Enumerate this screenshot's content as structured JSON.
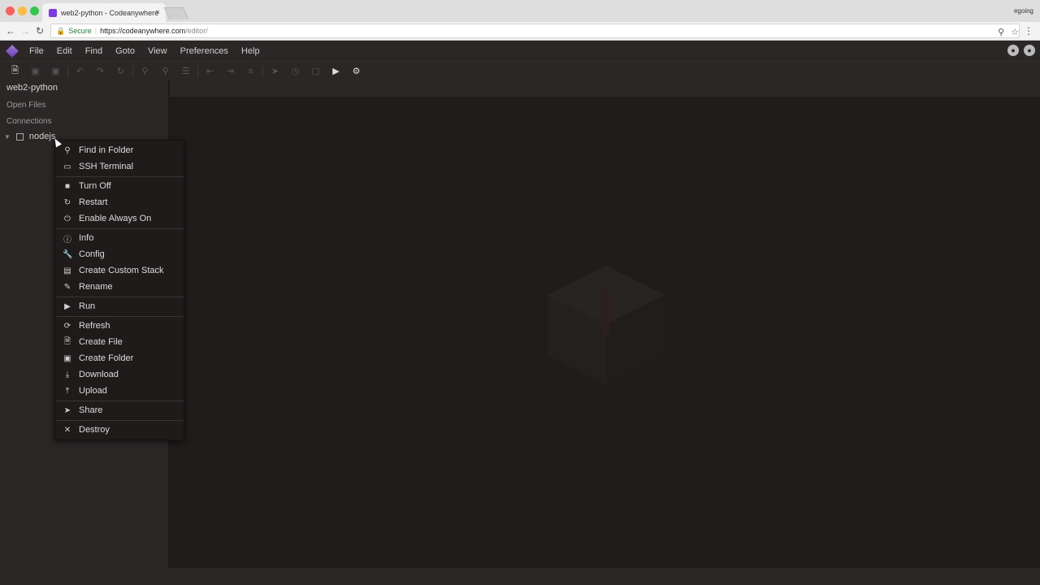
{
  "browser": {
    "tab_title": "web2-python - Codeanywhere",
    "tab_close": "×",
    "profile": "egoing",
    "secure_label": "Secure",
    "url_host": "https://codeanywhere.com",
    "url_path": "/editor/"
  },
  "menubar": {
    "items": [
      "File",
      "Edit",
      "Find",
      "Goto",
      "View",
      "Preferences",
      "Help"
    ]
  },
  "sidebar": {
    "project": "web2-python",
    "open_files": "Open Files",
    "connections": "Connections",
    "node_label": "nodejs"
  },
  "context_menu": {
    "groups": [
      [
        {
          "label": "Find in Folder",
          "icon": "search-icon"
        },
        {
          "label": "SSH Terminal",
          "icon": "terminal-icon"
        }
      ],
      [
        {
          "label": "Turn Off",
          "icon": "stop-icon"
        },
        {
          "label": "Restart",
          "icon": "restart-icon"
        },
        {
          "label": "Enable Always On",
          "icon": "power-icon"
        }
      ],
      [
        {
          "label": "Info",
          "icon": "info-icon"
        },
        {
          "label": "Config",
          "icon": "wrench-icon"
        },
        {
          "label": "Create Custom Stack",
          "icon": "stack-icon"
        },
        {
          "label": "Rename",
          "icon": "pencil-icon"
        }
      ],
      [
        {
          "label": "Run",
          "icon": "play-icon"
        }
      ],
      [
        {
          "label": "Refresh",
          "icon": "refresh-icon"
        },
        {
          "label": "Create File",
          "icon": "new-file-icon"
        },
        {
          "label": "Create Folder",
          "icon": "new-folder-icon"
        },
        {
          "label": "Download",
          "icon": "download-icon"
        },
        {
          "label": "Upload",
          "icon": "upload-icon"
        }
      ],
      [
        {
          "label": "Share",
          "icon": "share-icon"
        }
      ],
      [
        {
          "label": "Destroy",
          "icon": "close-icon"
        }
      ]
    ]
  },
  "icon_glyphs": {
    "search-icon": "⚲",
    "terminal-icon": "▭",
    "stop-icon": "■",
    "restart-icon": "↻",
    "power-icon": "⏻",
    "info-icon": "ⓘ",
    "wrench-icon": "🔧",
    "stack-icon": "▤",
    "pencil-icon": "✎",
    "play-icon": "▶",
    "refresh-icon": "⟳",
    "new-file-icon": "🗎",
    "new-folder-icon": "▣",
    "download-icon": "⤓",
    "upload-icon": "⤒",
    "share-icon": "➤",
    "close-icon": "✕"
  },
  "colors": {
    "accent": "#7c3aed",
    "background": "#201c1c",
    "panel": "#2b2727"
  }
}
